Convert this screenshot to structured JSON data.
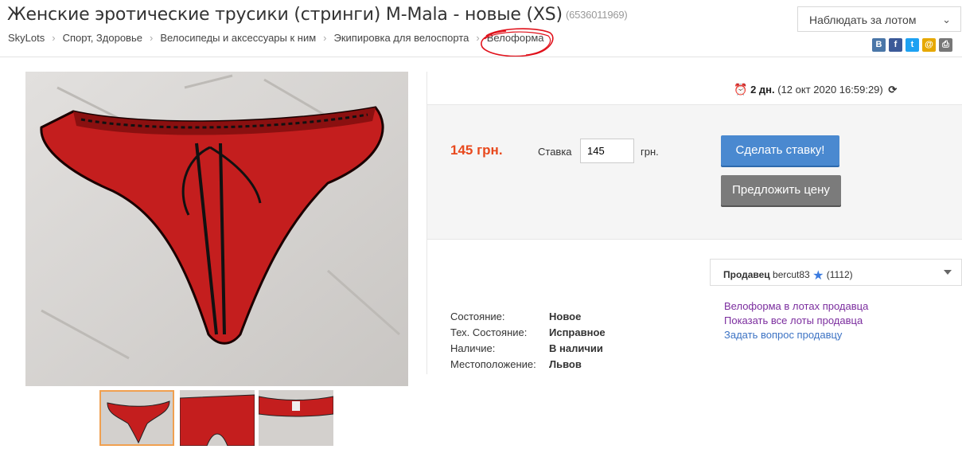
{
  "header": {
    "title": "Женские эротические трусики (стринги) M-Mala - новые (XS)",
    "lot_id": "(6536011969)",
    "watch_label": "Наблюдать за лотом"
  },
  "breadcrumbs": [
    "SkyLots",
    "Спорт, Здоровье",
    "Велосипеды и аксессуары к ним",
    "Экипировка для велоспорта",
    "Велоформа"
  ],
  "share_icons": [
    {
      "name": "vkontakte-icon",
      "glyph": "B",
      "color": "#4a76a8"
    },
    {
      "name": "facebook-icon",
      "glyph": "f",
      "color": "#3b5998"
    },
    {
      "name": "twitter-icon",
      "glyph": "t",
      "color": "#1da1f2"
    },
    {
      "name": "email-icon",
      "glyph": "@",
      "color": "#e6a800"
    },
    {
      "name": "print-icon",
      "glyph": "⎙",
      "color": "#777777"
    }
  ],
  "timer": {
    "remaining": "2 дн.",
    "end_time": "(12 окт 2020 16:59:29)"
  },
  "bid": {
    "price": "145 грн.",
    "stake_label": "Ставка",
    "stake_value": "145",
    "currency": "грн.",
    "bid_button": "Сделать ставку!",
    "offer_button": "Предложить цену"
  },
  "seller": {
    "label": "Продавец",
    "name": "bercut83",
    "rating": "(1112)"
  },
  "seller_links": [
    "Велоформа в лотах продавца",
    "Показать все лоты продавца",
    "Задать вопрос продавцу"
  ],
  "specs": [
    {
      "key": "Состояние:",
      "value": "Новое"
    },
    {
      "key": "Тех. Состояние:",
      "value": "Исправное"
    },
    {
      "key": "Наличие:",
      "value": "В наличии"
    },
    {
      "key": "Местоположение:",
      "value": "Львов"
    }
  ],
  "colors": {
    "price": "#e8491d",
    "bid_button": "#4a89d0",
    "offer_button": "#7b7b7b",
    "annotation_circle": "#e0101a"
  }
}
